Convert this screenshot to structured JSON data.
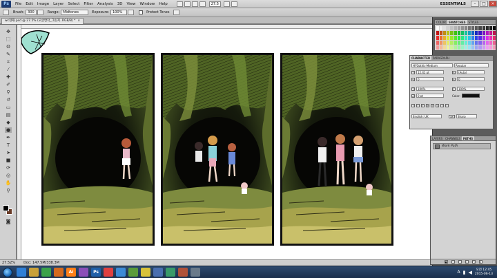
{
  "menubar": {
    "logo": "Ps",
    "items": [
      "File",
      "Edit",
      "Image",
      "Layer",
      "Select",
      "Filter",
      "Analysis",
      "3D",
      "View",
      "Window",
      "Help"
    ],
    "zoom": "27.5",
    "workspace": "ESSENTIALS",
    "win_minimize": "–",
    "win_restore": "□",
    "win_close": "×"
  },
  "options": {
    "brush_label": "Brush:",
    "brush_size": "300",
    "range_label": "Range:",
    "range_value": "Midtones",
    "exposure_label": "Exposure:",
    "exposure_value": "100%",
    "protect_label": "Protect Tones"
  },
  "document": {
    "tab_title": "wc현재.psd @ 27.5% (오글연작_그린지..RGB/8) *",
    "close": "×"
  },
  "status": {
    "zoom": "27.52%",
    "doc_size": "Doc: 147.5M/338.3M"
  },
  "character_panel": {
    "tabs": [
      "CHARACTER",
      "PARAGRAPH"
    ],
    "font_family": "HYGothic-Medium",
    "font_style": "Regular",
    "font_size": "12.41 pt",
    "leading": "(Auto)",
    "kerning": "0",
    "tracking": "0",
    "vertical_scale": "100%",
    "horizontal_scale": "100%",
    "baseline_shift": "0 pt",
    "color_label": "Color:",
    "style_buttons": [
      "T",
      "T",
      "TT",
      "Tr",
      "T'",
      "T,",
      "T",
      "T"
    ],
    "language": "English: UK",
    "antialias_icon": "aa",
    "antialias": "Sharp"
  },
  "swatches_panel": {
    "tabs": [
      "COLOR",
      "SWATCHES",
      "STYLES"
    ]
  },
  "paths_panel": {
    "tabs": [
      "LAYERS",
      "CHANNELS",
      "PATHS"
    ],
    "item": "Work Path"
  },
  "taskbar": {
    "apps": [
      {
        "label": "",
        "color": "#2f7fd6",
        "icon": "ie-icon"
      },
      {
        "label": "",
        "color": "#c9a13a",
        "icon": "folder-icon"
      },
      {
        "label": "",
        "color": "#3aa24a",
        "icon": "media-icon"
      },
      {
        "label": "",
        "color": "#d46a1f",
        "icon": "firefox-icon"
      },
      {
        "label": "Ai",
        "color": "#ff7f18",
        "icon": "illustrator-icon"
      },
      {
        "label": "",
        "color": "#8a4fb8",
        "icon": "paint-icon"
      },
      {
        "label": "Ps",
        "color": "#1f5fa8",
        "icon": "photoshop-icon"
      },
      {
        "label": "",
        "color": "#e04040",
        "icon": "viewer-icon"
      },
      {
        "label": "",
        "color": "#3c8ad6",
        "icon": "tool-icon"
      },
      {
        "label": "",
        "color": "#5a9b3a",
        "icon": "app-icon"
      },
      {
        "label": "",
        "color": "#d8c23a",
        "icon": "chat-icon"
      },
      {
        "label": "",
        "color": "#4a6fb0",
        "icon": "word-icon"
      },
      {
        "label": "",
        "color": "#3a9a6a",
        "icon": "sheet-icon"
      },
      {
        "label": "",
        "color": "#b0523a",
        "icon": "notes-icon"
      },
      {
        "label": "",
        "color": "#6a7a8a",
        "icon": "settings-icon"
      }
    ],
    "time": "오전 12:45",
    "date": "2015-06-13",
    "language": "A"
  }
}
